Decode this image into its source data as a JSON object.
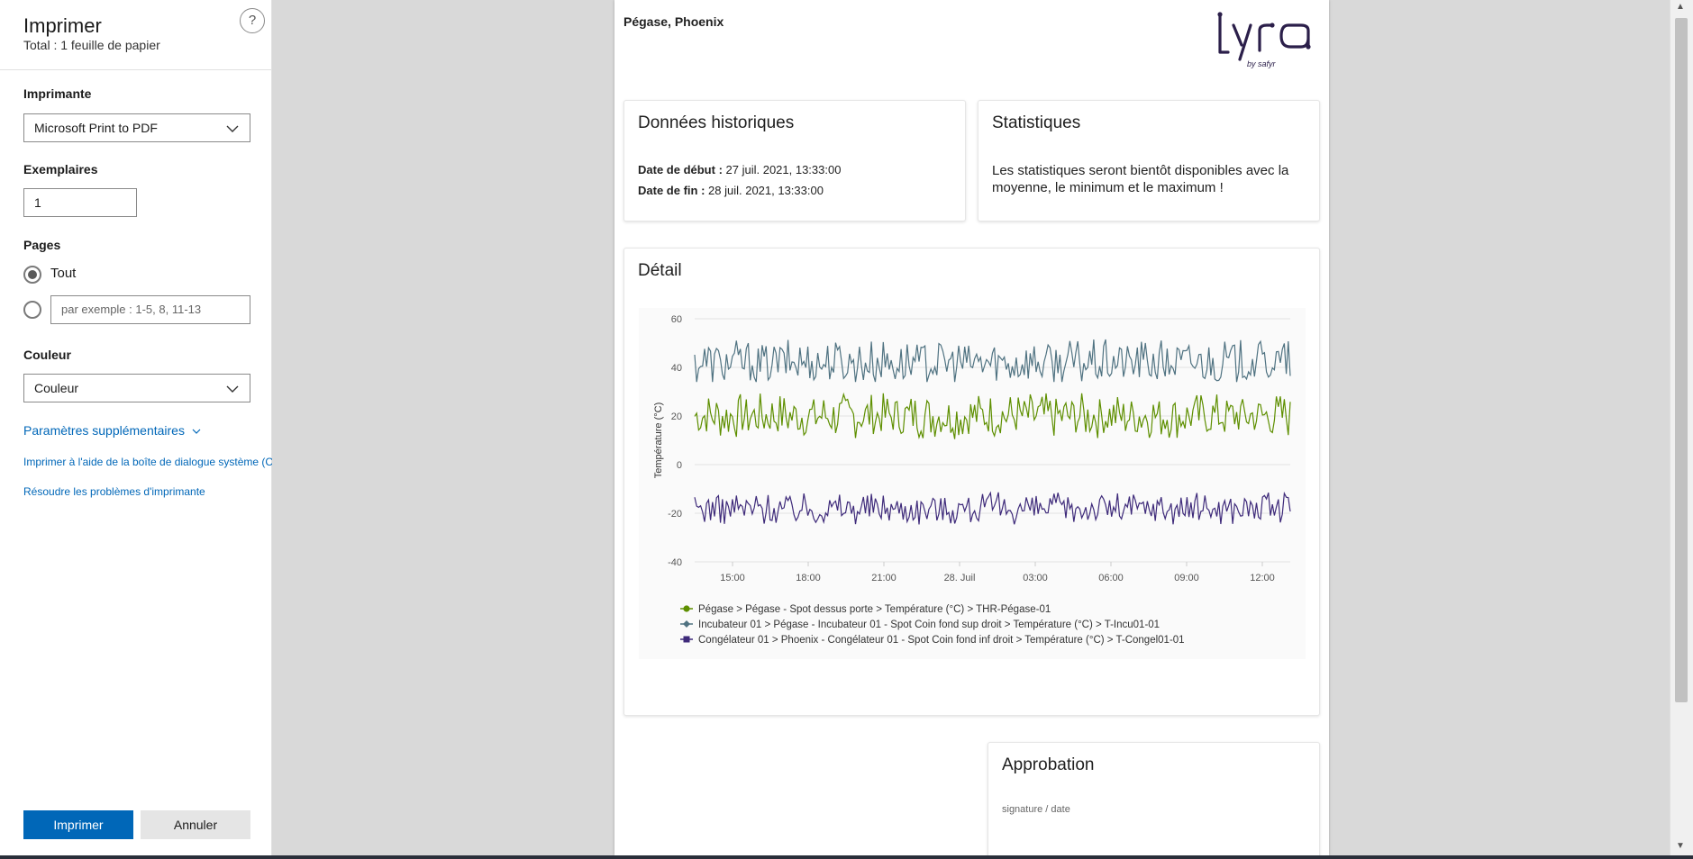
{
  "dialog": {
    "title": "Imprimer",
    "total": "Total : 1 feuille de papier",
    "help_label": "?",
    "printer_label": "Imprimante",
    "printer_value": "Microsoft Print to PDF",
    "copies_label": "Exemplaires",
    "copies_value": "1",
    "pages_label": "Pages",
    "pages_all": "Tout",
    "pages_placeholder": "par exemple : 1-5, 8, 11-13",
    "color_label": "Couleur",
    "color_value": "Couleur",
    "more_settings": "Paramètres supplémentaires",
    "system_dialog": "Imprimer à l'aide de la boîte de dialogue système (Ct",
    "troubleshoot": "Résoudre les problèmes d'imprimante",
    "print_button": "Imprimer",
    "cancel_button": "Annuler"
  },
  "page": {
    "location": "Pégase, Phoenix",
    "logo_text": "Lyra",
    "logo_sub": "by safyr",
    "historic": {
      "title": "Données historiques",
      "start_label": "Date de début :",
      "start_value": " 27 juil. 2021, 13:33:00",
      "end_label": "Date de fin :",
      "end_value": " 28 juil. 2021, 13:33:00"
    },
    "stats": {
      "title": "Statistiques",
      "text": "Les statistiques seront bientôt disponibles avec la moyenne, le minimum et le maximum !"
    },
    "detail": {
      "title": "Détail"
    },
    "approval": {
      "title": "Approbation",
      "subtitle": "signature / date"
    }
  },
  "chart_data": {
    "type": "line",
    "title": "",
    "xlabel": "",
    "ylabel": "Température (°C)",
    "ylim": [
      -40,
      60
    ],
    "yticks": [
      60,
      40,
      20,
      0,
      -20,
      -40
    ],
    "x_range": [
      "27 juil. 2021, 13:33:00",
      "28 juil. 2021, 13:33:00"
    ],
    "xticks": [
      "15:00",
      "18:00",
      "21:00",
      "28. Juil",
      "03:00",
      "06:00",
      "09:00",
      "12:00"
    ],
    "grid": true,
    "legend_position": "bottom",
    "series": [
      {
        "name": "Pégase > Pégase - Spot dessus porte > Température (°C) > THR-Pégase-01",
        "color": "#5e8f00",
        "marker": "circle",
        "center": 20,
        "min": 10,
        "max": 30
      },
      {
        "name": "Incubateur 01 > Pégase - Incubateur 01 - Spot Coin fond sup droit > Température (°C) > T-Incu01-01",
        "color": "#4f7281",
        "marker": "diamond",
        "center": 40,
        "min": 34,
        "max": 54
      },
      {
        "name": "Congélateur 01 > Phoenix - Congélateur 01 - Spot Coin fond inf droit > Température (°C) > T-Congel01-01",
        "color": "#3e2a7a",
        "marker": "square",
        "center": -18,
        "min": -25,
        "max": -11
      }
    ]
  }
}
